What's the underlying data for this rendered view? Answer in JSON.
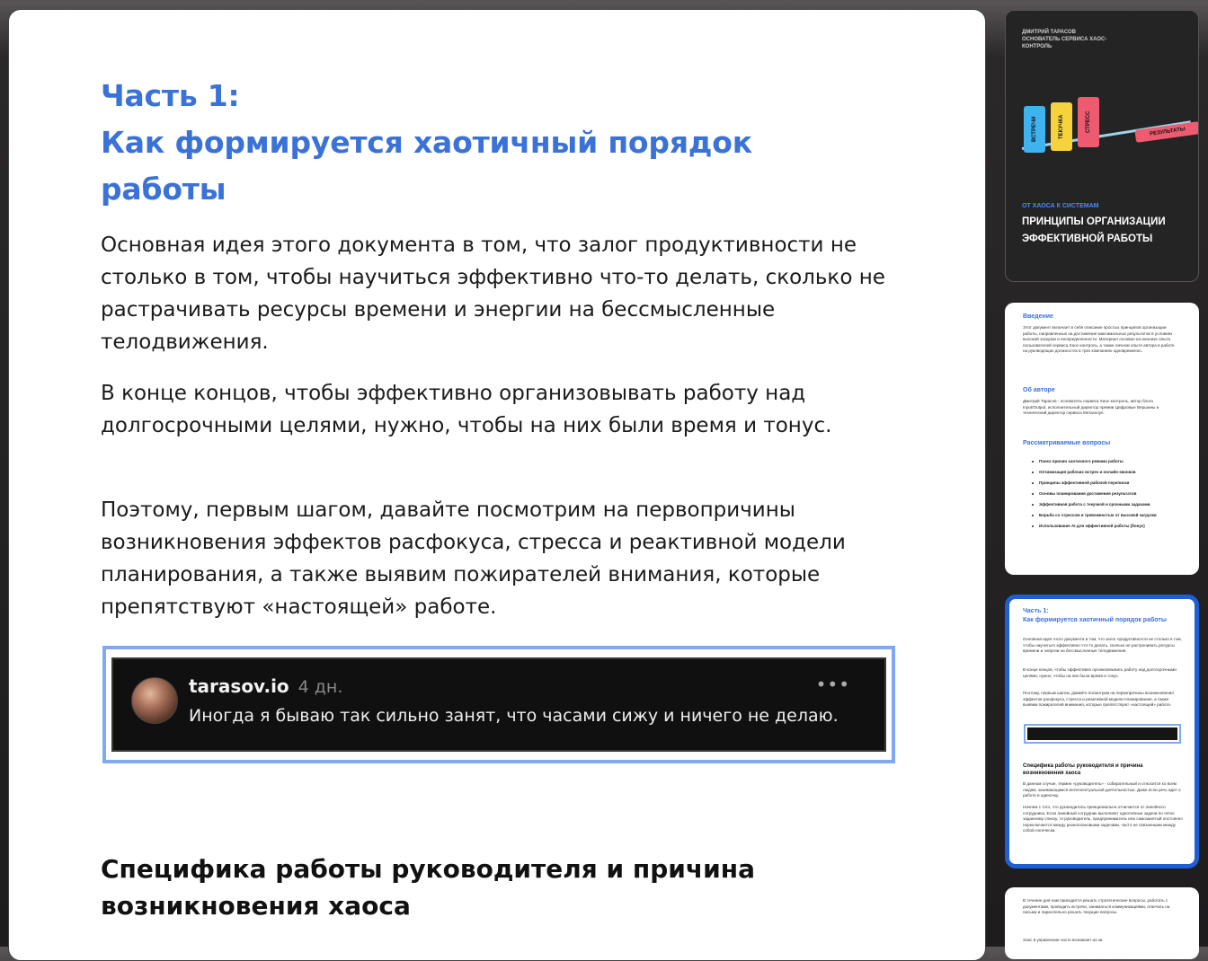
{
  "document": {
    "heading": {
      "line1": "Часть 1:",
      "line2": "Как формируется хаотичный порядок",
      "line3": "работы"
    },
    "paragraphs": [
      "Основная идея этого документа в том, что залог продуктивности не столько в том, чтобы научиться эффективно что-то делать, сколько не растрачивать ресурсы времени и энергии на бессмысленные телодвижения.",
      "В конце концов, чтобы эффективно организовывать работу над долгосрочными целями, нужно, чтобы на них были время и тонус.",
      "Поэтому, первым шагом, давайте посмотрим на первопричины возникновения эффектов расфокуса, стресса и реактивной модели планирования, а также выявим пожирателей внимания, которые препятствуют «настоящей» работе."
    ],
    "quote": {
      "username": "tarasov.io",
      "time": "4 дн.",
      "text": "Иногда я бываю так сильно занят, что часами сижу и ничего не делаю.",
      "more": "•••"
    },
    "subheading": {
      "line1": "Специфика работы руководителя и причина",
      "line2": "возникновения хаоса"
    }
  },
  "thumbnails": {
    "cover": {
      "author": "ДМИТРИЙ ТАРАСОВ",
      "author_role": "ОСНОВАТЕЛЬ СЕРВИСА ХАОС-КОНТРОЛЬ",
      "blocks": [
        "ВСТРЕЧИ",
        "ТЕКУЧКА",
        "СТРЕСС"
      ],
      "result": "РЕЗУЛЬТАТЫ",
      "subtitle": "ОТ ХАОСА К СИСТЕМАМ",
      "title": "ПРИНЦИПЫ ОРГАНИЗАЦИИ ЭФФЕКТИВНОЙ РАБОТЫ"
    },
    "intro": {
      "h_intro": "Введение",
      "p_intro": "Этот документ включает в себя описание простых принципов организации работы, направленных на достижение максимальных результатов в условиях высокой загрузки и неопределенности. Материал основан на анализе опыта пользователей сервиса Хаос-контроль, а также личном опыте автора в работе на руководящих должностях в трех компаниях одновременно.",
      "h_author": "Об авторе",
      "p_author": "Дмитрий Тарасов - основатель сервиса Хаос-контроль, автор блога Input/Output, исполнительный директор премии Цифровые Вершины и технический директор сервиса Метаскоуп.",
      "h_topics": "Рассматриваемые вопросы",
      "topics": [
        "Поиск причин хаотичного режима работы",
        "Оптимизация рабочих встреч и онлайн-звонков",
        "Принципы эффективной рабочей переписки",
        "Основы планирования достижения результатов",
        "Эффективная работа с текучкой и срочными задачами",
        "Борьба со стрессом и тревожностью от высокой загрузки",
        "Использование AI для эффективной работы (бонус)"
      ]
    },
    "part1": {
      "h1": "Часть 1:",
      "h2": "Как формируется хаотичный порядок работы",
      "p1": "Основная идея этого документа в том, что залог продуктивности не столько в том, чтобы научиться эффективно что-то делать, сколько не растрачивать ресурсы времени и энергии на бессмысленные телодвижения.",
      "p2": "В конце концов, чтобы эффективно организовывать работу над долгосрочными целями, нужно, чтобы на них были время и тонус.",
      "p3": "Поэтому, первым шагом, давайте посмотрим на первопричины возникновения эффектов расфокуса, стресса и реактивной модели планирования, а также выявим пожирателей внимания, которые препятствуют «настоящей» работе.",
      "sub": "Специфика работы руководителя и причина возникновения хаоса",
      "p4": "В данном случае, термин «руководитель» - собирательный и относится ко всем людям, занимающимся интеллектуальной деятельностью. Даже если речь идет о работе в одиночку.",
      "p5": "Начнем с того, что руководитель принципиально отличается от линейного сотрудника. Если линейный сотрудник выполняет однотипные задачи по четко заданному списку, то руководитель, предприниматель или самозанятый постоянно переключается между разноплановыми задачами, часто не связанными между собой логически."
    },
    "page4": {
      "p1": "В течение дня нам приходится решать стратегические вопросы, работать с документами, проводить встречи, заниматься коммуникациями, отвечать на письма и параллельно решать текущие вопросы.",
      "p2": "Хаос в управлении часто возникает из-за"
    }
  }
}
